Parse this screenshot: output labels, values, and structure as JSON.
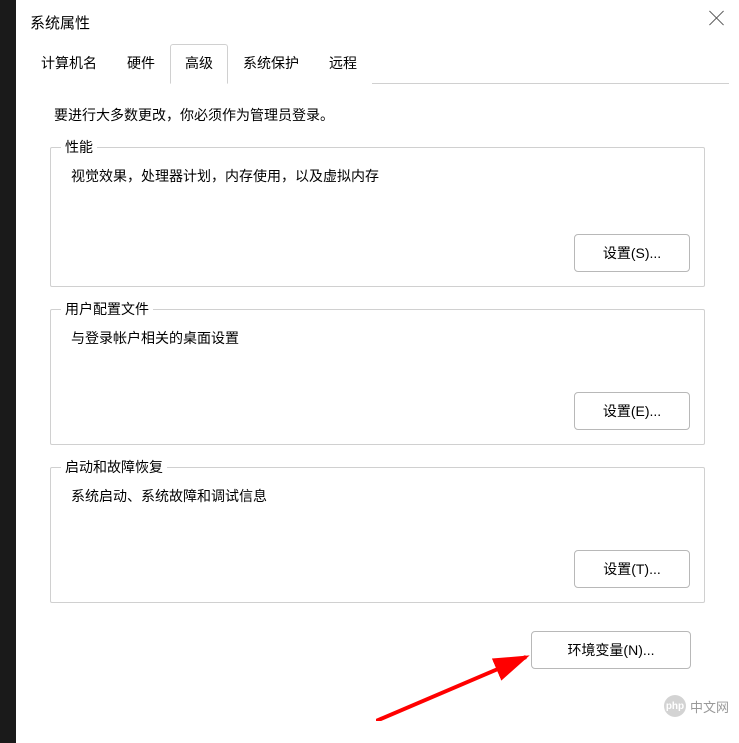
{
  "title": "系统属性",
  "tabs": {
    "computer_name": "计算机名",
    "hardware": "硬件",
    "advanced": "高级",
    "system_protection": "系统保护",
    "remote": "远程"
  },
  "intro": "要进行大多数更改，你必须作为管理员登录。",
  "groups": {
    "performance": {
      "label": "性能",
      "desc": "视觉效果，处理器计划，内存使用，以及虚拟内存",
      "button": "设置(S)..."
    },
    "user_profiles": {
      "label": "用户配置文件",
      "desc": "与登录帐户相关的桌面设置",
      "button": "设置(E)..."
    },
    "startup_recovery": {
      "label": "启动和故障恢复",
      "desc": "系统启动、系统故障和调试信息",
      "button": "设置(T)..."
    }
  },
  "env_var_button": "环境变量(N)...",
  "watermark": {
    "logo": "php",
    "text": "中文网"
  },
  "colors": {
    "arrow": "#ff0000",
    "border": "#d0d0d0"
  }
}
